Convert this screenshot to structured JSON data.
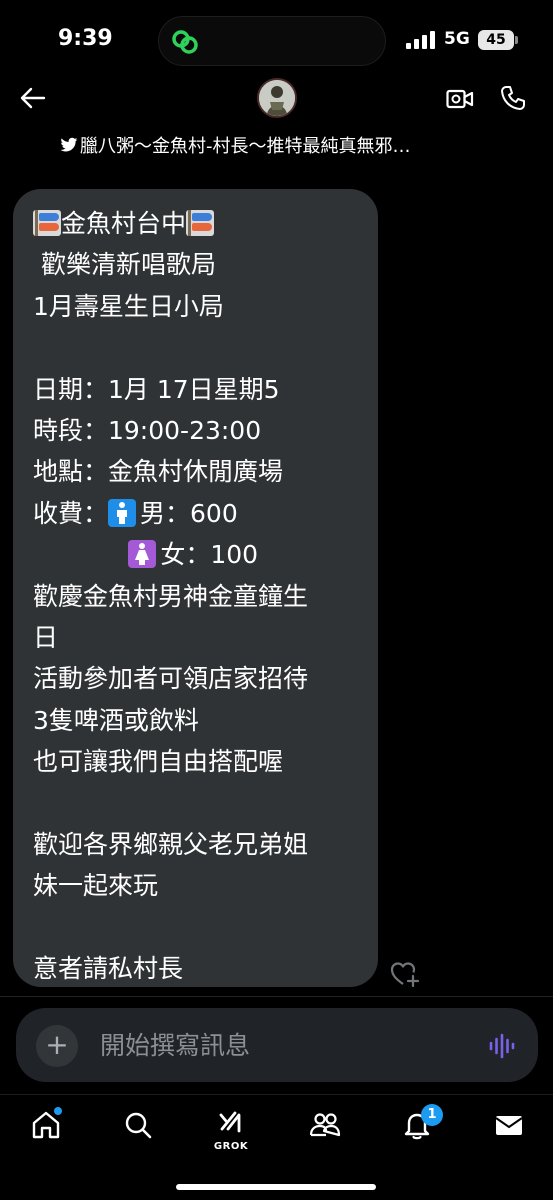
{
  "status_bar": {
    "time": "9:39",
    "network": "5G",
    "battery": "45"
  },
  "header": {
    "contact_name": "臘八粥～金魚村-村長～推特最純真無邪…",
    "icons": [
      "back-arrow-icon",
      "avatar",
      "video-call-icon",
      "phone-call-icon"
    ]
  },
  "message": {
    "lines": [
      {
        "text": "金魚村台中",
        "flags": true
      },
      {
        "text": " 歡樂清新唱歌局"
      },
      {
        "text": "1月壽星生日小局"
      },
      {
        "text": ""
      },
      {
        "text": "日期：1月 17日星期5"
      },
      {
        "text": "時段：19:00-23:00"
      },
      {
        "text": "地點：金魚村休閒廣場"
      },
      {
        "prefix": "收費：",
        "text": "男：600",
        "gender": "male"
      },
      {
        "prefix": "            ",
        "text": "女：100",
        "gender": "female"
      },
      {
        "text": "歡慶金魚村男神金童鐘生"
      },
      {
        "text": "日"
      },
      {
        "text": "活動參加者可領店家招待"
      },
      {
        "text": "3隻啤酒或飲料"
      },
      {
        "text": "也可讓我們自由搭配喔"
      },
      {
        "text": ""
      },
      {
        "text": "歡迎各界鄉親父老兄弟姐"
      },
      {
        "text": "妹一起來玩"
      },
      {
        "text": ""
      },
      {
        "text": "意者請私村長"
      }
    ],
    "reaction_icon": "heart-plus-icon"
  },
  "composer": {
    "placeholder": "開始撰寫訊息"
  },
  "tabbar": {
    "grok_label": "GROK",
    "notification_count": "1",
    "accent": "#1d9bf0"
  },
  "colors": {
    "bubble": "#2f3336",
    "voice_accent": "#7b61e8"
  }
}
